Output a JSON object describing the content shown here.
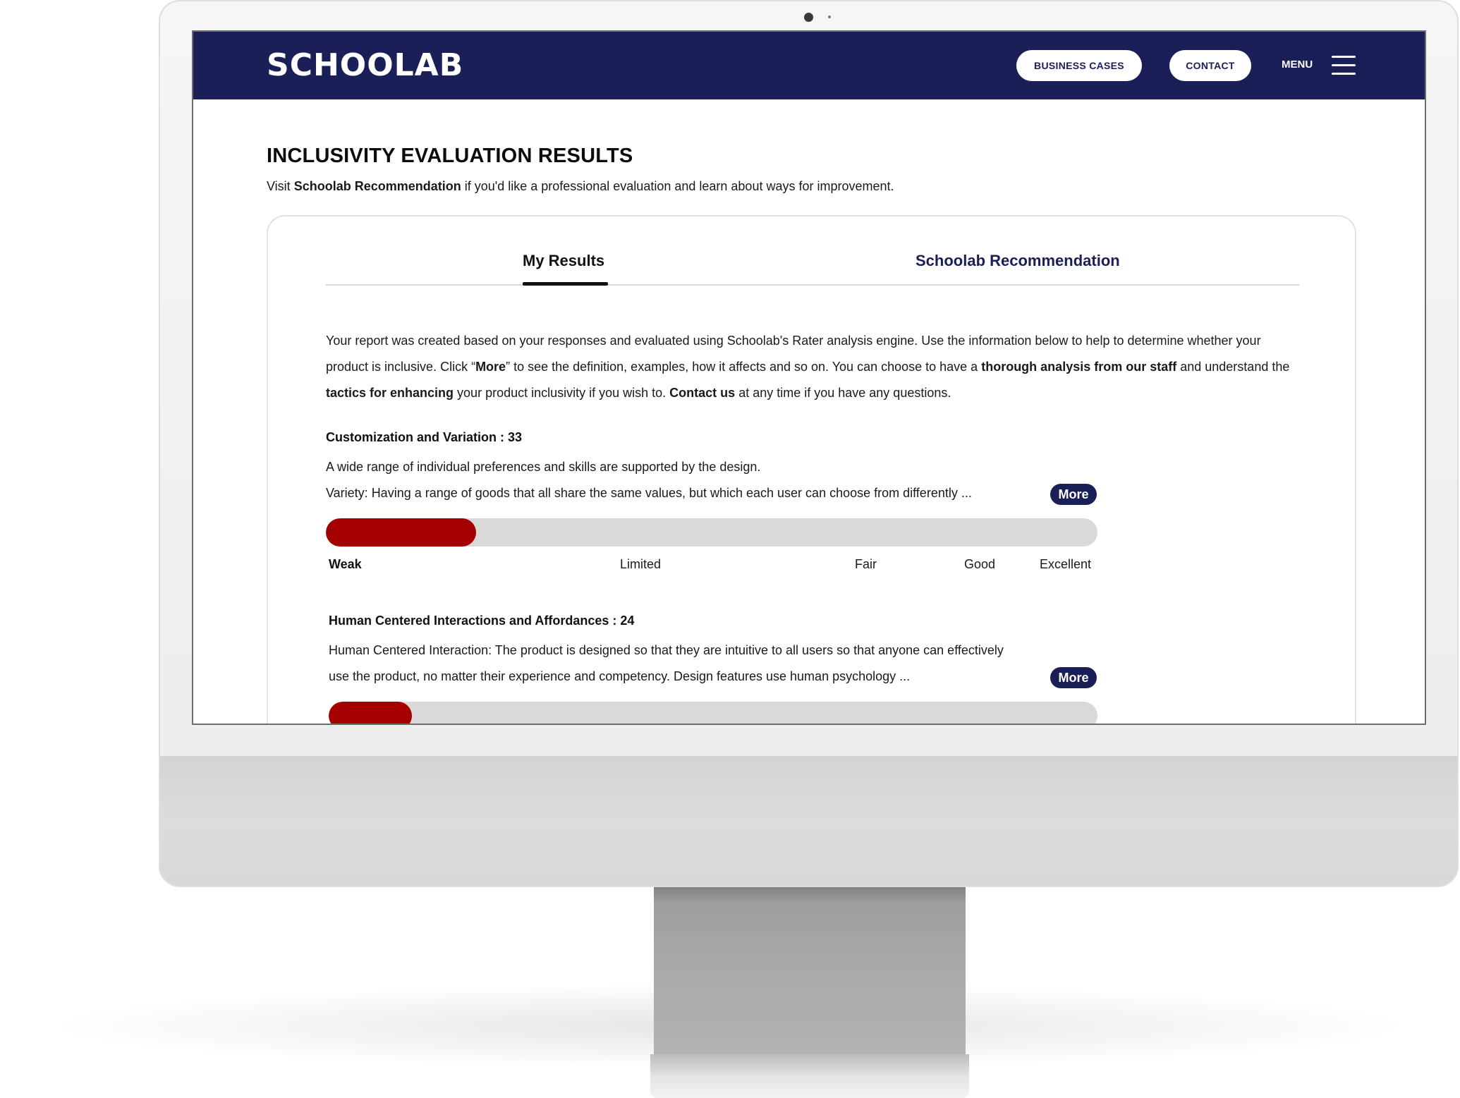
{
  "header": {
    "logo_text": "SCHOOLAB",
    "nav": {
      "business_cases": "BUSINESS CASES",
      "contact": "CONTACT",
      "menu": "MENU"
    },
    "colors": {
      "nav_background": "#1a1f57",
      "accent_bar": "#a40000",
      "track": "#d9d9d9"
    }
  },
  "page": {
    "title": "INCLUSIVITY EVALUATION RESULTS",
    "subtitle_prefix": "Visit ",
    "subtitle_link": "Schoolab Recommendation",
    "subtitle_suffix": " if you'd like a professional evaluation and learn about ways for improvement."
  },
  "tabs": {
    "my_results": "My Results",
    "recommendation": "Schoolab Recommendation",
    "active": "My Results"
  },
  "intro": {
    "p1": "Your report was created based on your responses and evaluated using Schoolab's Rater analysis engine. Use the information below to help to determine whether your product is inclusive. Click “",
    "more_word": "More",
    "p2": "” to see the definition, examples, how it affects and so on. You can choose to have a ",
    "thorough": "thorough analysis from our staff",
    "p3": " and understand the ",
    "tactics": "tactics for enhancing",
    "p4": " your product inclusivity if you wish to. ",
    "contact": "Contact us",
    "p5": " at any time if you have any questions."
  },
  "sections": [
    {
      "title": "Customization and Variation : 33",
      "line1": "A wide range of individual preferences and skills are supported by the design.",
      "line2": "Variety: Having a range of goods that all share the same values, but which each user can choose from differently ...",
      "more": "More",
      "score_fraction": 0.195
    },
    {
      "title": "Human Centered Interactions and Affordances : 24",
      "line1": "Human Centered Interaction: The product is designed so that they are intuitive to all users so that anyone can effectively",
      "line2": "use the product, no matter their experience and competency. Design features use human psychology ...",
      "more": "More",
      "score_fraction": 0.108
    }
  ],
  "scale": {
    "weak": "Weak",
    "limited": "Limited",
    "fair": "Fair",
    "good": "Good",
    "excellent": "Excellent"
  }
}
